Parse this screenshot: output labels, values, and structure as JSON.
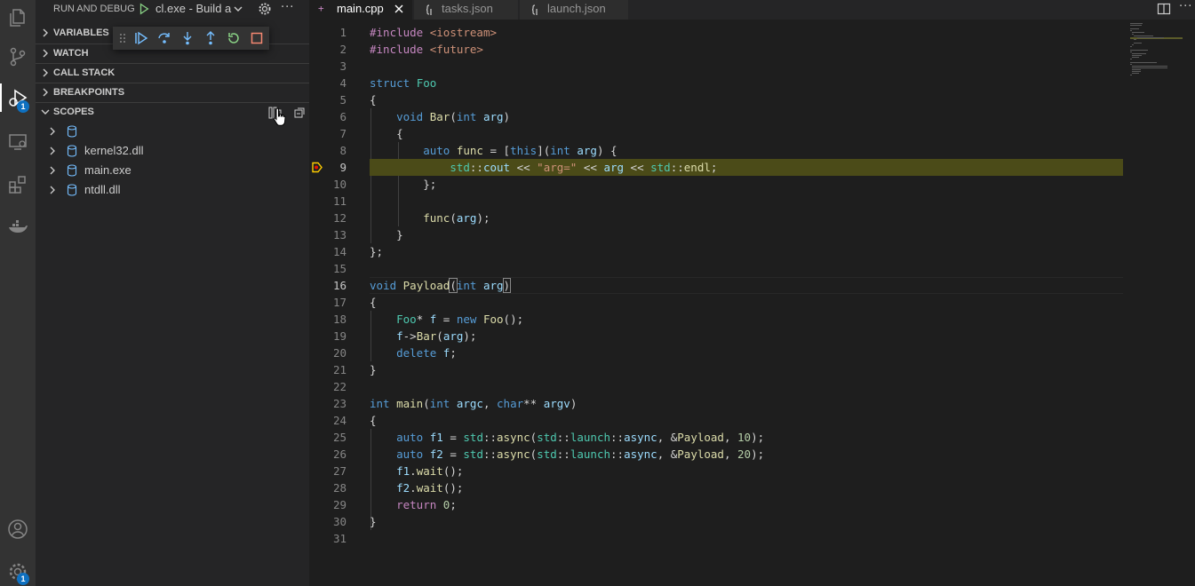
{
  "sidebar": {
    "title": "RUN AND DEBUG",
    "config": "cl.exe - Build a",
    "sections": {
      "variables": "VARIABLES",
      "watch": "WATCH",
      "call_stack": "CALL STACK",
      "breakpoints": "BREAKPOINTS",
      "scopes": "SCOPES"
    },
    "scopes_items": [
      "",
      "kernel32.dll",
      "main.exe",
      "ntdll.dll"
    ]
  },
  "activity": {
    "debug_badge": "1",
    "settings_badge": "1"
  },
  "tabs": [
    {
      "name": "main.cpp",
      "icon": "C++"
    },
    {
      "name": "tasks.json",
      "icon": "{}"
    },
    {
      "name": "launch.json",
      "icon": "{}"
    }
  ],
  "code": {
    "lines": [
      "1",
      "2",
      "3",
      "4",
      "5",
      "6",
      "7",
      "8",
      "9",
      "10",
      "11",
      "12",
      "13",
      "14",
      "15",
      "16",
      "17",
      "18",
      "19",
      "20",
      "21",
      "22",
      "23",
      "24",
      "25",
      "26",
      "27",
      "28",
      "29",
      "30",
      "31"
    ]
  },
  "colors": {
    "accent": "#0e70c0",
    "breakpoint_highlight": "#4b4b18",
    "breakpoint_marker": "#ffcc00"
  }
}
